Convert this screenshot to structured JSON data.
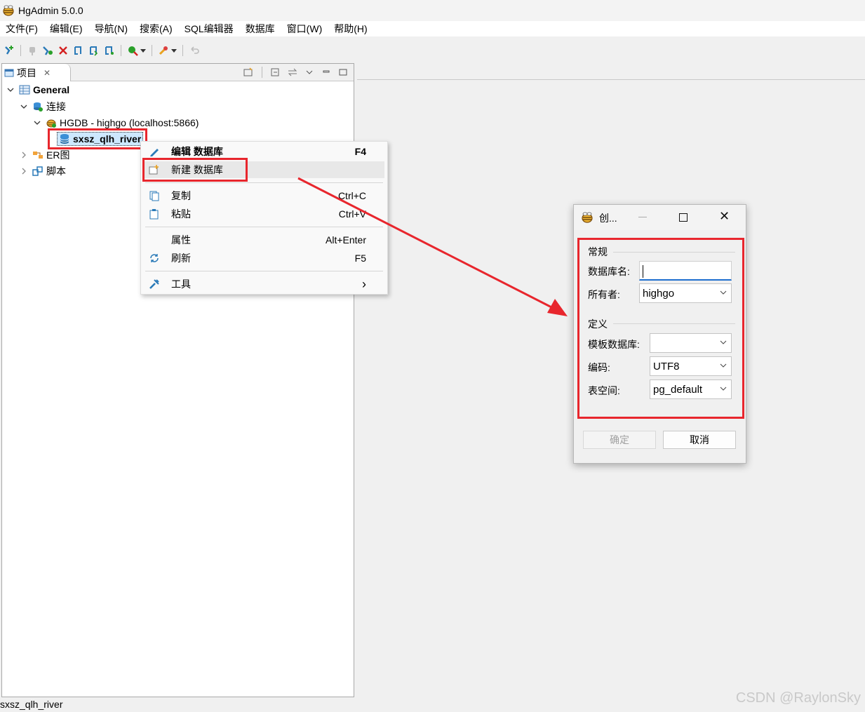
{
  "window": {
    "title": "HgAdmin 5.0.0"
  },
  "menubar": {
    "items": [
      "文件(F)",
      "编辑(E)",
      "导航(N)",
      "搜索(A)",
      "SQL编辑器",
      "数据库",
      "窗口(W)",
      "帮助(H)"
    ]
  },
  "project_panel": {
    "tab_label": "项目",
    "tree": {
      "root": "General",
      "connections": "连接",
      "server": "HGDB - highgo (localhost:5866)",
      "database": "sxsz_qlh_river",
      "er": "ER图",
      "scripts": "脚本"
    }
  },
  "context_menu": {
    "edit_db": {
      "label": "编辑 数据库",
      "key": "F4"
    },
    "new_db": {
      "label": "新建 数据库",
      "key": ""
    },
    "copy": {
      "label": "复制",
      "key": "Ctrl+C"
    },
    "paste": {
      "label": "粘贴",
      "key": "Ctrl+V"
    },
    "props": {
      "label": "属性",
      "key": "Alt+Enter"
    },
    "refresh": {
      "label": "刷新",
      "key": "F5"
    },
    "tools": {
      "label": "工具",
      "key": "›"
    }
  },
  "dialog": {
    "title": "创...",
    "general_group": "常规",
    "db_name_label": "数据库名:",
    "db_name_value": "",
    "owner_label": "所有者:",
    "owner_value": "highgo",
    "definition_group": "定义",
    "template_label": "模板数据库:",
    "template_value": "",
    "encoding_label": "编码:",
    "encoding_value": "UTF8",
    "tablespace_label": "表空间:",
    "tablespace_value": "pg_default",
    "ok_label": "确定",
    "cancel_label": "取消"
  },
  "status": {
    "text": "sxsz_qlh_river"
  },
  "watermark": "CSDN @RaylonSky",
  "colors": {
    "highlight_red": "#e8262d",
    "selection": "#cde8ff",
    "focus_blue": "#1f6fcf"
  }
}
